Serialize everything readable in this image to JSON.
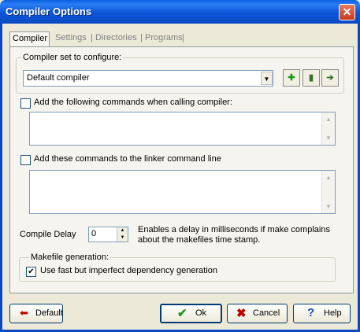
{
  "window": {
    "title": "Compiler Options",
    "close_glyph": "✕"
  },
  "tabs": [
    {
      "label": "Compiler"
    },
    {
      "label": "Settings"
    },
    {
      "label": "Directories"
    },
    {
      "label": "Programs"
    }
  ],
  "tab_separator": "|",
  "compiler_set": {
    "label": "Compiler set to configure:",
    "selected": "Default compiler",
    "add_icon": "plus-icon",
    "delete_icon": "trash-icon",
    "rename_icon": "rename-arrow-icon"
  },
  "compiler_commands": {
    "checkbox_label": "Add the following commands when calling compiler:",
    "checked": false,
    "value": ""
  },
  "linker_commands": {
    "checkbox_label": "Add these commands to the linker command line",
    "checked": false,
    "value": ""
  },
  "compile_delay": {
    "label": "Compile Delay",
    "value": "0",
    "description_line1": "Enables a delay in milliseconds if make complains",
    "description_line2": "about the makefiles time stamp."
  },
  "makefile": {
    "group_label": "Makefile generation:",
    "checkbox_label": "Use fast but imperfect dependency generation",
    "checked": true
  },
  "buttons": {
    "default_label": "Default",
    "ok_label": "Ok",
    "cancel_label": "Cancel",
    "help_label": "Help"
  },
  "colors": {
    "titlebar": "#0a5fe0",
    "dialog": "#ece9d8",
    "close": "#c8391a"
  }
}
